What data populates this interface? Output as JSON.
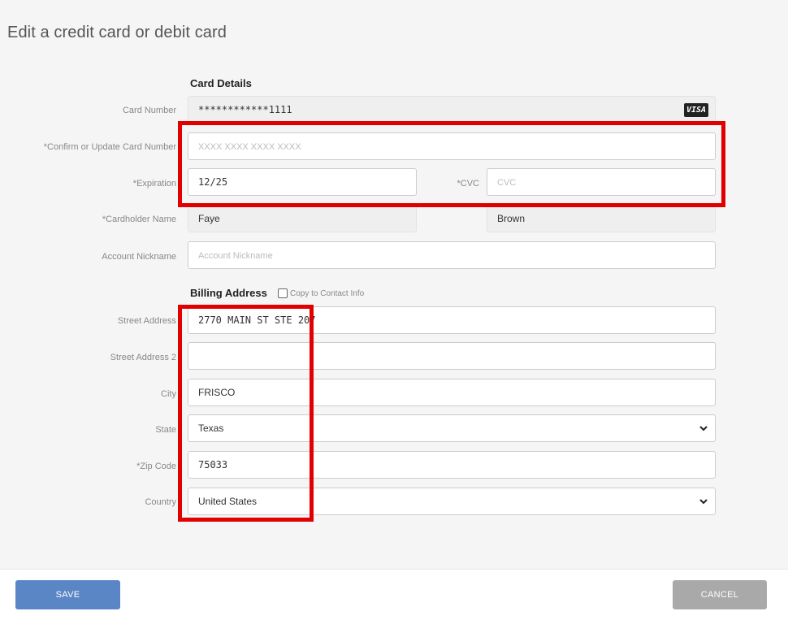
{
  "page": {
    "title": "Edit a credit card or debit card"
  },
  "card_details": {
    "heading": "Card Details",
    "card_number": {
      "label": "Card Number",
      "value": "************1111",
      "brand": "VISA"
    },
    "confirm_number": {
      "label": "*Confirm or Update Card Number",
      "placeholder": "XXXX XXXX XXXX XXXX",
      "value": ""
    },
    "expiration": {
      "label": "*Expiration",
      "value": "12/25"
    },
    "cvc": {
      "label": "*CVC",
      "placeholder": "CVC",
      "value": ""
    },
    "cardholder": {
      "label": "*Cardholder Name",
      "first": "Faye",
      "last": "Brown"
    },
    "nickname": {
      "label": "Account Nickname",
      "placeholder": "Account Nickname",
      "value": ""
    }
  },
  "billing": {
    "heading": "Billing Address",
    "copy_label": "Copy to Contact Info",
    "copy_checked": false,
    "street": {
      "label": "Street Address",
      "value": "2770 MAIN ST STE 207"
    },
    "street2": {
      "label": "Street Address 2",
      "value": ""
    },
    "city": {
      "label": "City",
      "value": "FRISCO"
    },
    "state": {
      "label": "State",
      "value": "Texas"
    },
    "zip": {
      "label": "*Zip Code",
      "value": "75033"
    },
    "country": {
      "label": "Country",
      "value": "United States"
    }
  },
  "footer": {
    "save_label": "SAVE",
    "cancel_label": "CANCEL"
  },
  "colors": {
    "highlight": "#e00000",
    "save": "#5b86c5",
    "cancel": "#a9a9a9",
    "background": "#f5f5f5"
  }
}
